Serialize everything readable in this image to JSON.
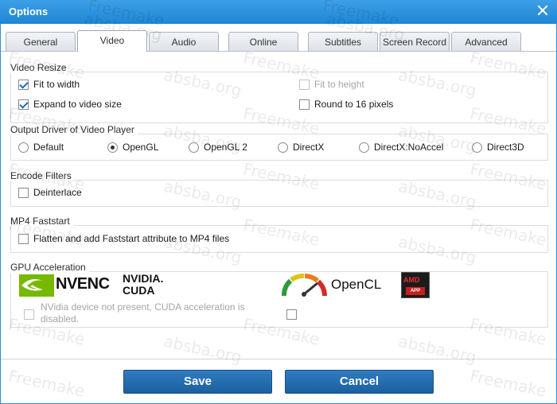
{
  "window": {
    "title": "Options"
  },
  "tabs": [
    {
      "label": "General",
      "active": false
    },
    {
      "label": "Video",
      "active": true
    },
    {
      "label": "Audio",
      "active": false
    },
    {
      "label": "Online",
      "active": false
    },
    {
      "label": "Subtitles",
      "active": false
    },
    {
      "label": "Screen Record",
      "active": false
    },
    {
      "label": "Advanced",
      "active": false
    }
  ],
  "video_resize": {
    "label": "Video Resize",
    "fit_to_width": {
      "label": "Fit to width",
      "checked": true
    },
    "expand_to_video_size": {
      "label": "Expand to video size",
      "checked": true
    },
    "fit_to_height": {
      "label": "Fit to height",
      "checked": false,
      "disabled": true
    },
    "round_to_16": {
      "label": "Round to 16 pixels",
      "checked": false
    }
  },
  "output_driver": {
    "label": "Output Driver of Video Player",
    "options": [
      "Default",
      "OpenGL",
      "OpenGL 2",
      "DirectX",
      "DirectX:NoAccel",
      "Direct3D"
    ],
    "selected": "OpenGL"
  },
  "encode_filters": {
    "label": "Encode Filters",
    "deinterlace": {
      "label": "Deinterlace",
      "checked": false
    }
  },
  "mp4_faststart": {
    "label": "MP4 Faststart",
    "flatten": {
      "label": "Flatten and add Faststart attribute to MP4 files",
      "checked": false
    }
  },
  "gpu": {
    "label": "GPU Acceleration",
    "nvenc_text": "NVENC",
    "nvidia_text": "NVIDIA.",
    "cuda_text": "CUDA",
    "cuda_message": "NVidia device not present, CUDA acceleration is disabled.",
    "opencl_text": "OpenCL",
    "amd_text": "AMD",
    "amd_app_text": "APP"
  },
  "buttons": {
    "save": "Save",
    "cancel": "Cancel"
  },
  "watermark": {
    "line1": "Freemake",
    "line2": "absba.org"
  },
  "colors": {
    "titlebar": "#2a8fd7",
    "button": "#1f68a8",
    "check": "#1c6fb5",
    "nvidia_green": "#76b900",
    "amd_red": "#c81e1e"
  }
}
